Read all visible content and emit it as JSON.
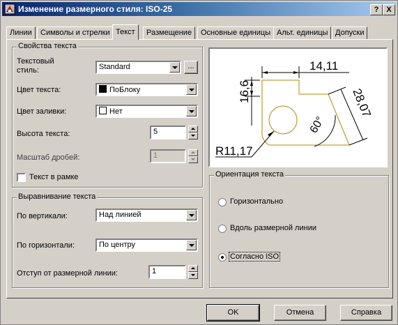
{
  "window": {
    "title": "Изменение размерного стиля: ISO-25",
    "help_btn": "?",
    "close_btn": "X"
  },
  "tabs": [
    {
      "label": "Линии"
    },
    {
      "label": "Символы и стрелки"
    },
    {
      "label": "Текст"
    },
    {
      "label": "Размещение"
    },
    {
      "label": "Основные единицы"
    },
    {
      "label": "Альт. единицы"
    },
    {
      "label": "Допуски"
    }
  ],
  "text_properties": {
    "legend": "Свойства текста",
    "style_label_line1": "Текстовый",
    "style_label_line2": "стиль:",
    "style_value": "Standard",
    "style_browse": "...",
    "text_color_label": "Цвет текста:",
    "text_color_value": "ПоБлоку",
    "text_color_swatch": "#000000",
    "fill_color_label": "Цвет заливки:",
    "fill_color_value": "Нет",
    "fill_color_swatch": "#ffffff",
    "height_label": "Высота текста:",
    "height_value": "5",
    "fraction_label": "Масштаб дробей:",
    "fraction_value": "1",
    "frame_label": "Текст в рамке"
  },
  "alignment": {
    "legend": "Выравнивание текста",
    "vertical_label": "По вертикали:",
    "vertical_value": "Над линией",
    "horizontal_label": "По горизонтали:",
    "horizontal_value": "По центру",
    "offset_label": "Отступ от размерной линии:",
    "offset_value": "1"
  },
  "preview": {
    "dim_top": "14,11",
    "dim_left": "16,6",
    "dim_right": "28,07",
    "dim_angle": "60°",
    "dim_radius": "R11,17"
  },
  "orientation": {
    "legend": "Ориентация текста",
    "options": [
      {
        "label": "Горизонтально",
        "selected": false
      },
      {
        "label": "Вдоль размерной линии",
        "selected": false
      },
      {
        "label": "Согласно ISO",
        "selected": true
      }
    ]
  },
  "buttons": {
    "ok": "OK",
    "cancel": "Отмена",
    "help": "Справка"
  }
}
